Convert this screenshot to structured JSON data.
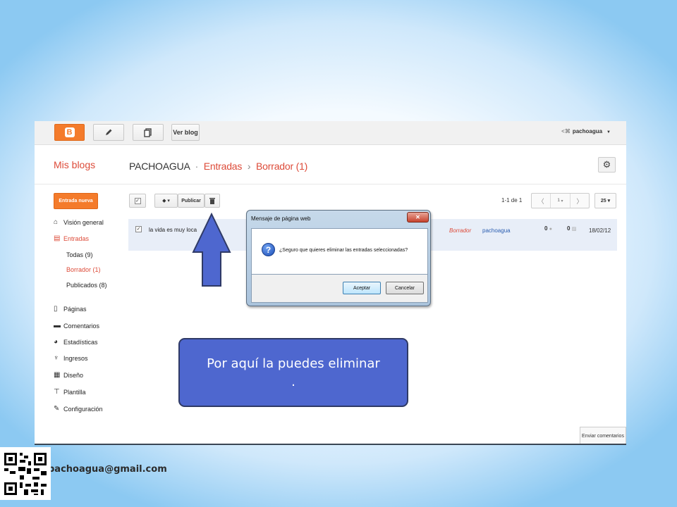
{
  "topbar": {
    "view_blog": "Ver blog",
    "user": "pachoagua"
  },
  "header": {
    "my_blogs": "Mis blogs",
    "breadcrumb": {
      "blog": "PACHOAGUA",
      "sep1": "·",
      "posts": "Entradas",
      "sep2": "›",
      "drafts": "Borrador (1)"
    }
  },
  "sidebar": {
    "new_post": "Entrada nueva",
    "items": [
      {
        "label": "Visión general"
      },
      {
        "label": "Entradas"
      },
      {
        "label": "Páginas"
      },
      {
        "label": "Comentarios"
      },
      {
        "label": "Estadísticas"
      },
      {
        "label": "Ingresos"
      },
      {
        "label": "Diseño"
      },
      {
        "label": "Plantilla"
      },
      {
        "label": "Configuración"
      }
    ],
    "sub": [
      {
        "label": "Todas (9)"
      },
      {
        "label": "Borrador (1)"
      },
      {
        "label": "Publicados (8)"
      }
    ]
  },
  "toolbar": {
    "publish": "Publicar",
    "count": "1-1 de 1",
    "page": "1",
    "per_page": "25"
  },
  "post": {
    "title": "la vida es muy loca",
    "status": "Borrador",
    "author": "pachoagua",
    "comments": "0",
    "views": "0",
    "date": "18/02/12"
  },
  "dialog": {
    "title": "Mensaje de página web",
    "message": "¿Seguro que quieres eliminar las entradas seleccionadas?",
    "accept": "Aceptar",
    "cancel": "Cancelar"
  },
  "feedback": "Enviar comentarios",
  "callout": {
    "line1": "Por aquí la puedes eliminar",
    "line2": "."
  },
  "email": "pachoagua@gmail.com",
  "colors": {
    "accent": "#f47b2b",
    "link": "#dd4b39",
    "callout": "#4e67cf"
  }
}
